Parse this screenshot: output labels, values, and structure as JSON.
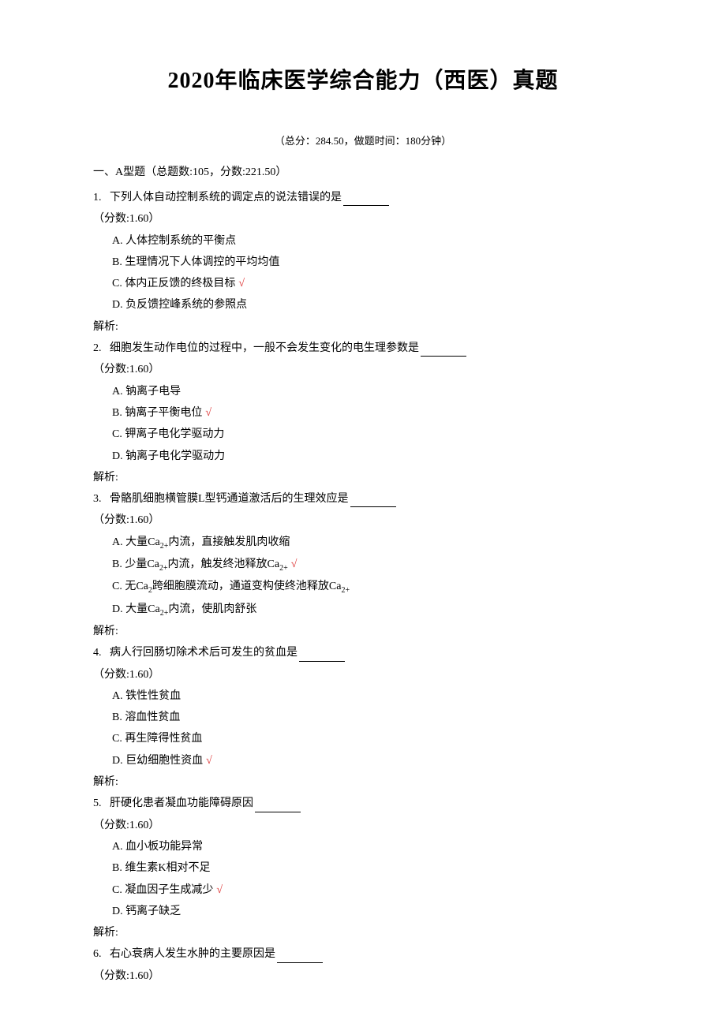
{
  "title": "2020年临床医学综合能力（西医）真题",
  "meta": "（总分：284.50，做题时间：180分钟）",
  "section": "一、A型题（总题数:105，分数:221.50）",
  "analysis_label": "解析:",
  "correct_mark": "√",
  "questions": [
    {
      "num": "1.",
      "stem": "下列人体自动控制系统的调定点的说法错误的是 ",
      "score": "（分数:1.60）",
      "options": [
        {
          "label": "A.",
          "text": "人体控制系统的平衡点",
          "correct": false
        },
        {
          "label": "B.",
          "text": "生理情况下人体调控的平均均值",
          "correct": false
        },
        {
          "label": "C.",
          "text": "体内正反馈的终极目标",
          "correct": true
        },
        {
          "label": "D.",
          "text": "负反馈控峰系统的参照点",
          "correct": false
        }
      ]
    },
    {
      "num": "2.",
      "stem": "细胞发生动作电位的过程中，一般不会发生变化的电生理参数是 ",
      "score": "（分数:1.60）",
      "options": [
        {
          "label": "A.",
          "text": "钠离子电导",
          "correct": false
        },
        {
          "label": "B.",
          "text": "钠离子平衡电位",
          "correct": true
        },
        {
          "label": "C.",
          "text": "钾离子电化学驱动力",
          "correct": false
        },
        {
          "label": "D.",
          "text": "钠离子电化学驱动力",
          "correct": false
        }
      ]
    },
    {
      "num": "3.",
      "stem": "骨骼肌细胞横管膜L型钙通道激活后的生理效应是 ",
      "score": "（分数:1.60）",
      "options": [
        {
          "label": "A.",
          "text_html": "大量Ca<span class=\"sub\">2+</span>内流，直接触发肌肉收缩",
          "correct": false
        },
        {
          "label": "B.",
          "text_html": "少量Ca<span class=\"sub\">2+</span>内流，触发终池释放Ca<span class=\"sub\">2+</span>",
          "correct": true
        },
        {
          "label": "C.",
          "text_html": "无Ca<span class=\"sub\">2</span>跨细胞膜流动，通道变构使终池释放Ca<span class=\"sub\">2+</span>",
          "correct": false
        },
        {
          "label": "D.",
          "text_html": "大量Ca<span class=\"sub\">2+</span>内流，使肌肉舒张",
          "correct": false
        }
      ]
    },
    {
      "num": "4.",
      "stem": "病人行回肠切除术术后可发生的贫血是",
      "score": "（分数:1.60）",
      "options": [
        {
          "label": "A.",
          "text": "铁性性贫血",
          "correct": false
        },
        {
          "label": "B.",
          "text": "溶血性贫血",
          "correct": false
        },
        {
          "label": "C.",
          "text": "再生障得性贫血",
          "correct": false
        },
        {
          "label": "D.",
          "text": "巨幼细胞性资血",
          "correct": true
        }
      ]
    },
    {
      "num": "5.",
      "stem": "肝硬化患者凝血功能障碍原因 ",
      "score": "（分数:1.60）",
      "options": [
        {
          "label": "A.",
          "text": "血小板功能异常",
          "correct": false
        },
        {
          "label": "B.",
          "text": "维生素K相对不足",
          "correct": false
        },
        {
          "label": "C.",
          "text": "凝血因子生成减少",
          "correct": true
        },
        {
          "label": "D.",
          "text": "钙离子缺乏",
          "correct": false
        }
      ]
    },
    {
      "num": "6.",
      "stem": "右心衰病人发生水肿的主要原因是 ",
      "score": "（分数:1.60）",
      "options": []
    }
  ]
}
